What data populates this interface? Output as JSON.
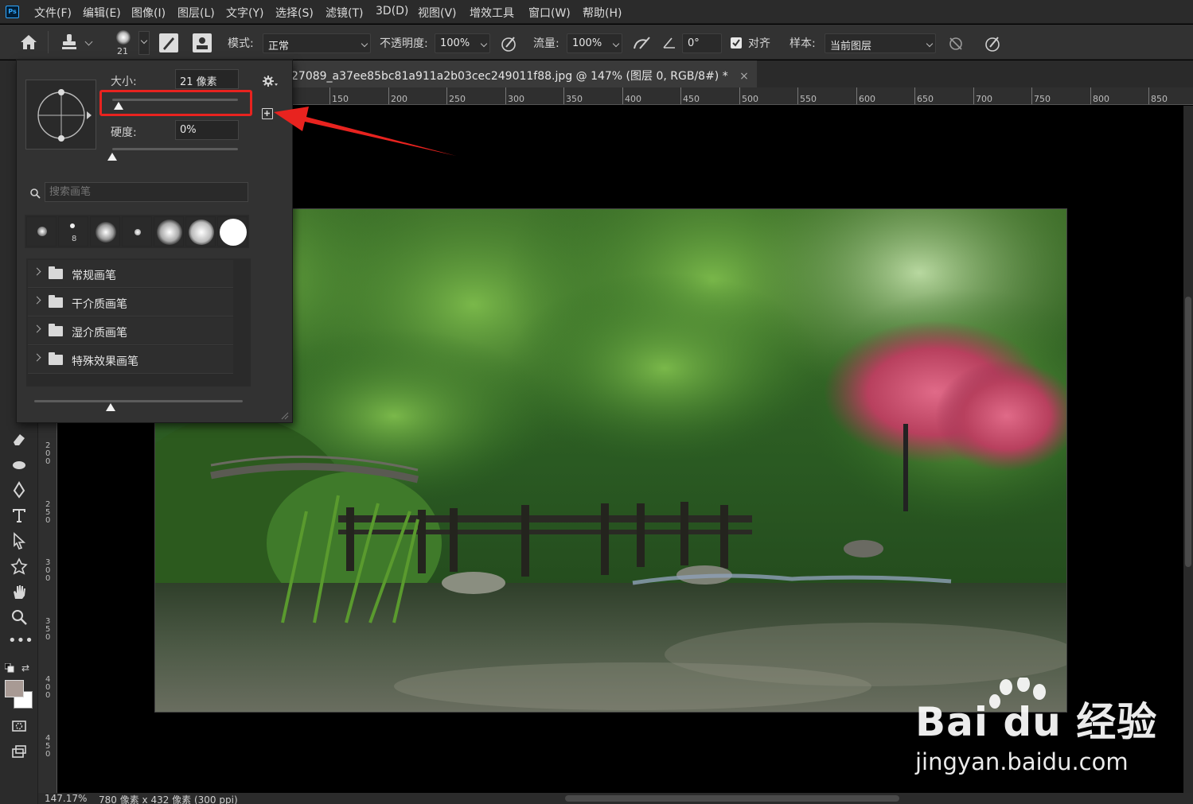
{
  "app": {
    "logo_text": "Ps"
  },
  "menubar": {
    "items": [
      "文件(F)",
      "编辑(E)",
      "图像(I)",
      "图层(L)",
      "文字(Y)",
      "选择(S)",
      "滤镜(T)",
      "3D(D)",
      "视图(V)",
      "增效工具",
      "窗口(W)",
      "帮助(H)"
    ]
  },
  "options": {
    "brush_size_preview": "21",
    "mode_label": "模式:",
    "mode_value": "正常",
    "opacity_label": "不透明度:",
    "opacity_value": "100%",
    "flow_label": "流量:",
    "flow_value": "100%",
    "angle_value": "0°",
    "align_label": "对齐",
    "align_checked": true,
    "sample_label": "样本:",
    "sample_value": "当前图层"
  },
  "document": {
    "tab_title": "27089_a37ee85bc81a911a2b03cec249011f88.jpg @ 147% (图层 0, RGB/8#) *",
    "close_glyph": "×"
  },
  "rulers": {
    "top": [
      "150",
      "200",
      "250",
      "300",
      "350",
      "400",
      "450",
      "500",
      "550",
      "600",
      "650",
      "700",
      "750",
      "800",
      "850"
    ],
    "left": [
      "200",
      "250",
      "300",
      "350",
      "400",
      "450"
    ]
  },
  "brush_panel": {
    "size_label": "大小:",
    "size_value": "21 像素",
    "size_fraction": 0.05,
    "hardness_label": "硬度:",
    "hardness_value": "0%",
    "hardness_fraction": 0.0,
    "search_placeholder": "搜索画笔",
    "preset_count_label": "8",
    "folders": [
      "常规画笔",
      "干介质画笔",
      "湿介质画笔",
      "特殊效果画笔"
    ]
  },
  "statusbar": {
    "zoom": "147.17%",
    "doc_info": "780 像素 x 432 像素 (300 ppi)"
  },
  "colors": {
    "annotation_red": "#e8231f",
    "foreground_swatch": "#a89a94",
    "background_swatch": "#ffffff"
  },
  "watermark": {
    "line1": "Bai du 经验",
    "line2": "jingyan.baidu.com"
  }
}
